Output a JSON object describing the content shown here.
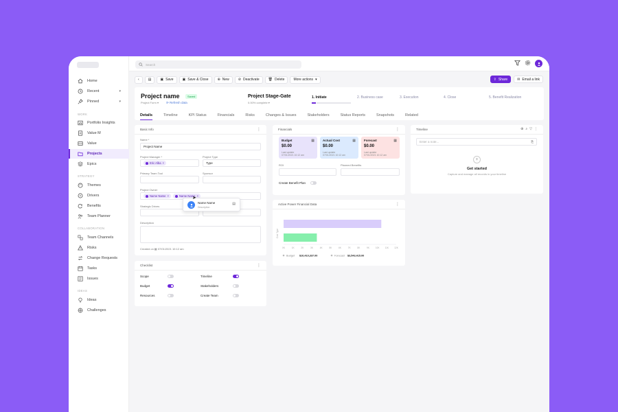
{
  "sidebar": {
    "items": [
      {
        "label": "Home",
        "icon": "home-icon"
      },
      {
        "label": "Recent",
        "icon": "clock-icon"
      },
      {
        "label": "Pinned",
        "icon": "pin-icon"
      }
    ],
    "work_section": "WORK",
    "work_items": [
      {
        "label": "Portfolio Insights"
      },
      {
        "label": "Value M"
      },
      {
        "label": "Value"
      },
      {
        "label": "Projects"
      },
      {
        "label": "Epics"
      }
    ],
    "strategy_section": "STRATEGY",
    "strategy_items": [
      {
        "label": "Themes"
      },
      {
        "label": "Drivers"
      },
      {
        "label": "Benefits"
      },
      {
        "label": "Team Planner"
      }
    ],
    "collab_section": "COLLABORATION",
    "collab_items": [
      {
        "label": "Team Channels"
      },
      {
        "label": "Risks"
      },
      {
        "label": "Change Requests"
      },
      {
        "label": "Tasks"
      },
      {
        "label": "Issues"
      }
    ],
    "ideas_section": "IDEAS",
    "ideas_items": [
      {
        "label": "Ideas"
      },
      {
        "label": "Challenges"
      }
    ]
  },
  "topbar": {
    "search_placeholder": "Search"
  },
  "toolbar": {
    "save": "Save",
    "save_close": "Save & Close",
    "new": "New",
    "deactivate": "Deactivate",
    "delete": "Delete",
    "more": "More actions",
    "share": "Share",
    "email": "Email a link"
  },
  "header": {
    "project_name": "Project name",
    "saved": "Saved",
    "form": "Project Form",
    "refresh": "Refresh data",
    "stage_title": "Project Stage-Gate",
    "stage_sub": "0.00% complete",
    "steps": [
      "1. Initiate",
      "2. Business case",
      "3. Execution",
      "4. Close",
      "5. Benefit Realization"
    ]
  },
  "tabs": [
    "Details",
    "Timeline",
    "KPI Status",
    "Financials",
    "Risks",
    "Changes & Issues",
    "Stakeholders",
    "Status Reports",
    "Snapshots",
    "Related"
  ],
  "basic_info": {
    "title": "Basic Info",
    "name_label": "Name *",
    "name_value": "Project Name",
    "pm_label": "Project Manager *",
    "pm_value": "Eric Alba",
    "type_label": "Project Type",
    "type_value": "Type",
    "primary_label": "Primary Team Tool",
    "sponsor_label": "Sponsor",
    "owner_label": "Project Owner",
    "owner_chip1": "Name Name",
    "owner_chip2": "Name Name",
    "strategic_label": "Strategic Drives",
    "desc_label": "Description",
    "created": "Created on",
    "created_date": "07/01/2021 10:12 am",
    "popup_name": "Name Name",
    "popup_sub": "Description"
  },
  "checklist": {
    "title": "Checklist",
    "items": [
      {
        "label": "Scope",
        "on": false
      },
      {
        "label": "Timeline",
        "on": true
      },
      {
        "label": "Budget",
        "on": true
      },
      {
        "label": "Stakeholders",
        "on": false
      },
      {
        "label": "Resources",
        "on": false
      },
      {
        "label": "Create Team",
        "on": false
      }
    ]
  },
  "financials": {
    "title": "Financials",
    "boxes": [
      {
        "title": "Budget",
        "value": "$0.00",
        "sub": "Last update",
        "date": "07/01/2021 10:12 am",
        "color": "#e8e3fb"
      },
      {
        "title": "Actual Cost",
        "value": "$0.00",
        "sub": "Last update",
        "date": "07/01/2021 10:12 am",
        "color": "#dbeafe"
      },
      {
        "title": "Forecast",
        "value": "$0.00",
        "sub": "Last update",
        "date": "07/01/2021 10:12 am",
        "color": "#fde2e2"
      }
    ],
    "roi_label": "ROI",
    "planned_label": "Planned Benefits",
    "create_plan": "Create Benefit Plan"
  },
  "chart_card": {
    "title": "Active Power Financial Data"
  },
  "chart_data": {
    "type": "bar",
    "orientation": "horizontal",
    "categories": [
      "Budget",
      "Forecast"
    ],
    "values": [
      10410337,
      3543415
    ],
    "colors": [
      "#d9cdfb",
      "#86efac"
    ],
    "x_ticks": [
      "0K",
      "1K",
      "2K",
      "3K",
      "4K",
      "5K",
      "6K",
      "7K",
      "8K",
      "9K",
      "10K",
      "11K",
      "12K"
    ],
    "ylabel": "Cost Type",
    "legend": [
      {
        "name": "Budget",
        "value": "$10,410,337.00"
      },
      {
        "name": "Forecast",
        "value": "$3,543,415.00"
      }
    ],
    "legend_placement": "bottom"
  },
  "timeline": {
    "title": "Timeline",
    "note_placeholder": "Enter a note...",
    "get_started": "Get started",
    "get_started_sub": "Capture and manage all records in your timeline"
  }
}
